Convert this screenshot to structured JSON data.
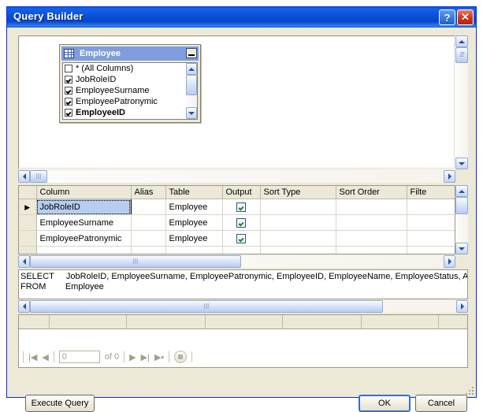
{
  "window": {
    "title": "Query Builder",
    "help_button": "?",
    "close_button": "✕"
  },
  "diagram": {
    "table": {
      "name": "Employee",
      "minimize_label": "_",
      "columns": [
        {
          "label": "* (All Columns)",
          "checked": false,
          "primary_key": false
        },
        {
          "label": "JobRoleID",
          "checked": true,
          "primary_key": false
        },
        {
          "label": "EmployeeSurname",
          "checked": true,
          "primary_key": false
        },
        {
          "label": "EmployeePatronymic",
          "checked": true,
          "primary_key": false
        },
        {
          "label": "EmployeeID",
          "checked": true,
          "primary_key": true
        }
      ]
    }
  },
  "criteria_grid": {
    "headers": [
      "",
      "Column",
      "Alias",
      "Table",
      "Output",
      "Sort Type",
      "Sort Order",
      "Filte"
    ],
    "rows": [
      {
        "marker": "▶",
        "column": "JobRoleID",
        "alias": "",
        "table": "Employee",
        "output": true,
        "sort_type": "",
        "sort_order": "",
        "filter": "",
        "selected": true
      },
      {
        "marker": "",
        "column": "EmployeeSurname",
        "alias": "",
        "table": "Employee",
        "output": true,
        "sort_type": "",
        "sort_order": "",
        "filter": "",
        "selected": false
      },
      {
        "marker": "",
        "column": "EmployeePatronymic",
        "alias": "",
        "table": "Employee",
        "output": true,
        "sort_type": "",
        "sort_order": "",
        "filter": "",
        "selected": false
      }
    ]
  },
  "sql": {
    "line1": "SELECT     JobRoleID, EmployeeSurname, EmployeePatronymic, EmployeeID, EmployeeName, EmployeeStatus, Acces",
    "line2": "FROM        Employee"
  },
  "results": {
    "navigator": {
      "first": "|◀",
      "previous": "◀",
      "position_value": "0",
      "position_placeholder": "",
      "of_label": "of 0",
      "next": "▶",
      "last": "▶|",
      "add_new": "▶▪",
      "stop": "■"
    }
  },
  "footer": {
    "execute_query": "Execute Query",
    "ok": "OK",
    "cancel": "Cancel"
  },
  "colors": {
    "titlebar_blue": "#0b51d8",
    "client_beige": "#ece9d8",
    "selection_blue": "#b6cdf0",
    "table_header_blue": "#7f9ddc",
    "check_green": "#1a8a1a",
    "close_red": "#d1341a"
  }
}
